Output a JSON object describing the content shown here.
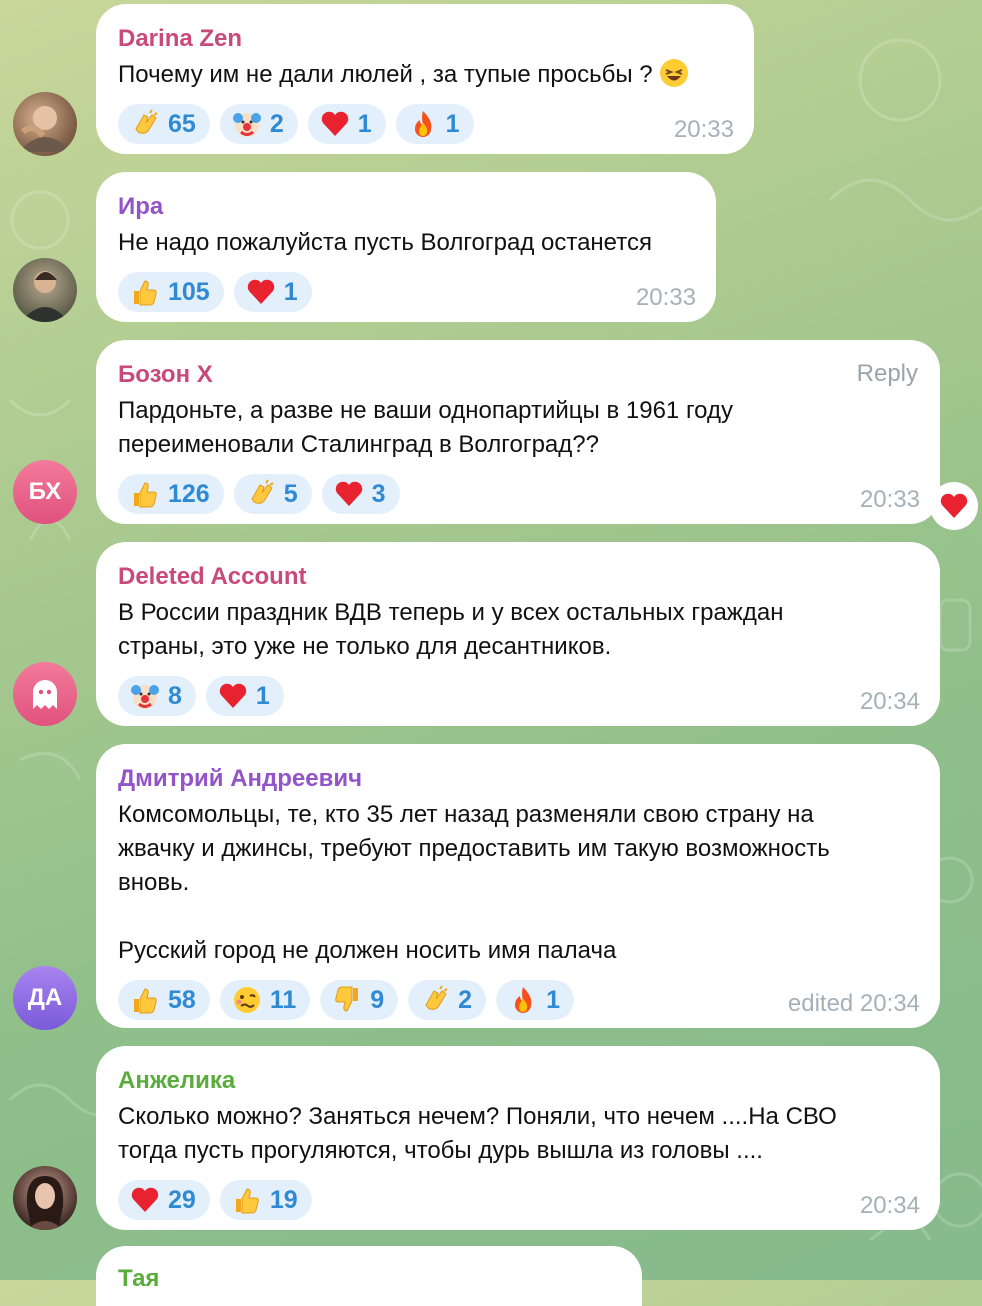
{
  "colors": {
    "author_pink": "#c94a79",
    "author_purple": "#9254c8",
    "author_green": "#5aac3c",
    "reaction_bg": "#e3f0fb",
    "reaction_text": "#2f8ad3",
    "time": "#a5b0b8"
  },
  "messages": [
    {
      "author": "Darina Zen",
      "text": "Почему им не дали люлей , за тупые просьбы ?",
      "reactions": [
        {
          "emoji": "clap-emoji",
          "count": "65"
        },
        {
          "emoji": "clown-emoji",
          "count": "2"
        },
        {
          "emoji": "heart-emoji",
          "count": "1"
        },
        {
          "emoji": "fire-emoji",
          "count": "1"
        }
      ],
      "time": "20:33"
    },
    {
      "author": "Ира",
      "text": "Не надо пожалуйста пусть Волгоград останется",
      "reactions": [
        {
          "emoji": "thumbs-up-emoji",
          "count": "105"
        },
        {
          "emoji": "heart-emoji",
          "count": "1"
        }
      ],
      "time": "20:33"
    },
    {
      "author": "Бозон X",
      "avatar_initials": "БХ",
      "reply_label": "Reply",
      "text": "Пардоньте, а разве не ваши однопартийцы в 1961 году\nпереименовали Сталинград в Волгоград??",
      "reactions": [
        {
          "emoji": "thumbs-up-emoji",
          "count": "126"
        },
        {
          "emoji": "clap-emoji",
          "count": "5"
        },
        {
          "emoji": "heart-emoji",
          "count": "3"
        }
      ],
      "time": "20:33"
    },
    {
      "author": "Deleted Account",
      "text": "В России праздник ВДВ теперь и у всех остальных граждан\nстраны, это уже не только для десантников.",
      "reactions": [
        {
          "emoji": "clown-emoji",
          "count": "8"
        },
        {
          "emoji": "heart-emoji",
          "count": "1"
        }
      ],
      "time": "20:34"
    },
    {
      "author": "Дмитрий Андреевич",
      "avatar_initials": "ДА",
      "text": "Комсомольцы, те, кто 35 лет назад разменяли свою страну на\nжвачку и джинсы, требуют предоставить им такую возможность\nвновь.\n\nРусский город не должен носить имя палача",
      "reactions": [
        {
          "emoji": "thumbs-up-emoji",
          "count": "58"
        },
        {
          "emoji": "woozy-emoji",
          "count": "11"
        },
        {
          "emoji": "thumbs-down-emoji",
          "count": "9"
        },
        {
          "emoji": "clap-emoji",
          "count": "2"
        },
        {
          "emoji": "fire-emoji",
          "count": "1"
        }
      ],
      "time": "edited 20:34"
    },
    {
      "author": "Анжелика",
      "text": "Сколько можно? Заняться нечем? Поняли, что нечем ....На СВО\nтогда пусть прогуляются, чтобы дурь вышла из головы ....",
      "reactions": [
        {
          "emoji": "heart-emoji",
          "count": "29"
        },
        {
          "emoji": "thumbs-up-emoji",
          "count": "19"
        }
      ],
      "time": "20:34"
    },
    {
      "author": "Тая"
    }
  ]
}
